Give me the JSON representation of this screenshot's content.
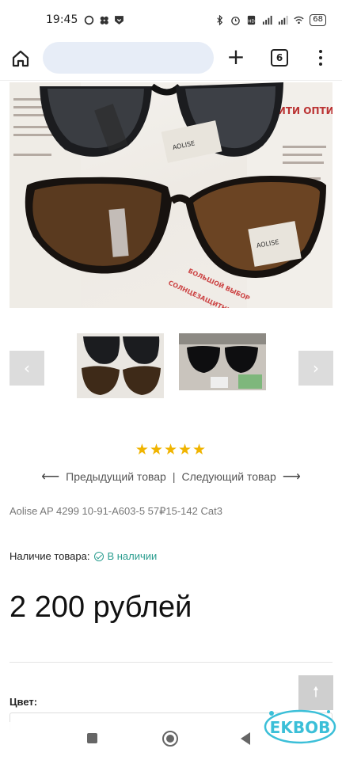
{
  "status_bar": {
    "time": "19:45",
    "battery": "68"
  },
  "browser": {
    "tab_count": "6",
    "plus": "+"
  },
  "photo_text": {
    "brand_tag_1": "AOLISE",
    "brand_tag_2": "AOLISE",
    "shop_sign": "СИТИ ОПТИКА",
    "ad_line_1": "БОЛЬШОЙ ВЫБОР",
    "ad_line_2": "СОЛНЦЕЗАЩИТНЫХ ОЧКОВ"
  },
  "carousel": {
    "prev_label": "‹",
    "next_label": "›"
  },
  "rating": {
    "stars": 5,
    "stars_text": "★★★★★",
    "color": "#f0b400"
  },
  "product_nav": {
    "prev_arrow": "⟵",
    "prev_label": "Предыдущий товар",
    "separator": "|",
    "next_label": "Следующий товар",
    "next_arrow": "⟶"
  },
  "product": {
    "sku_title": "Aolise AP 4299 10-91-A603-5 57₽15-142 Cat3",
    "availability_label": "Наличие товара:",
    "availability_status": "В наличии",
    "availability_color": "#2a9d8f",
    "price": "2 200 рублей",
    "color_label": "Цвет:"
  },
  "scroll_top": {
    "label": "🠕"
  },
  "watermark": {
    "text": "EKBOB"
  }
}
